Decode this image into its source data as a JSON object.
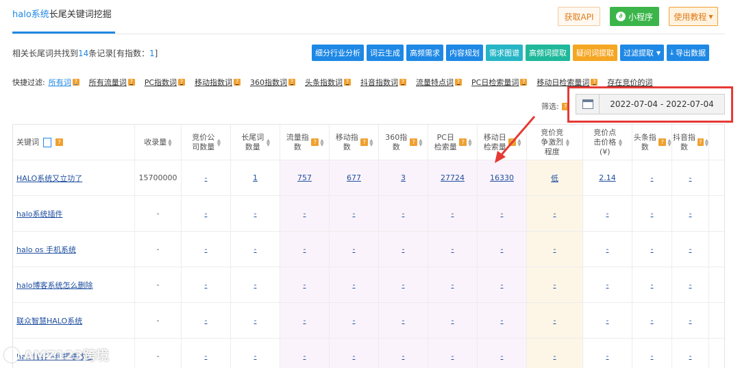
{
  "header": {
    "brand": "halo系统",
    "title_suffix": "长尾关键词挖掘",
    "api_button": "获取API",
    "mini_button": "小程序",
    "tutorial_button": "使用教程"
  },
  "summary": {
    "prefix": "相关长尾词共找到",
    "count": "14",
    "middle": "条记录[有指数：",
    "indexed": "1",
    "suffix": "]"
  },
  "toolbar": [
    {
      "label": "细分行业分析",
      "style": "blue"
    },
    {
      "label": "词云生成",
      "style": "blue"
    },
    {
      "label": "高频需求",
      "style": "blue"
    },
    {
      "label": "内容规划",
      "style": "blue"
    },
    {
      "label": "需求图谱",
      "style": "teal"
    },
    {
      "label": "高频词提取",
      "style": "green"
    },
    {
      "label": "疑问词提取",
      "style": "orange"
    },
    {
      "label": "过滤提取",
      "style": "blue"
    },
    {
      "label": "导出数据",
      "style": "blue"
    }
  ],
  "quick_filter": {
    "label": "快捷过滤:",
    "items": [
      "所有词",
      "所有流量词",
      "PC指数词",
      "移动指数词",
      "360指数词",
      "头条指数词",
      "抖音指数词",
      "流量特点词",
      "PC日检索量词",
      "移动日检索量词",
      "存在竞价的词"
    ]
  },
  "filter": {
    "label": "筛选:",
    "date_range": "2022-07-04 - 2022-07-04"
  },
  "table": {
    "headers": [
      "关键词",
      "收录量",
      "竞价公司数量",
      "长尾词数量",
      "流量指数",
      "移动指数",
      "360指数",
      "PC日检索量",
      "移动日检索量",
      "竞价竞争激烈程度",
      "竞价点击价格(¥)",
      "头条指数",
      "抖音指数"
    ],
    "rows": [
      [
        "HALO系统又立功了",
        "15700000",
        "-",
        "1",
        "757",
        "677",
        "3",
        "27724",
        "16330",
        "低",
        "2.14",
        "-",
        "-"
      ],
      [
        "halo系统插件",
        "-",
        "-",
        "-",
        "-",
        "-",
        "-",
        "-",
        "-",
        "-",
        "-",
        "-",
        "-"
      ],
      [
        "halo os 手机系统",
        "-",
        "-",
        "-",
        "-",
        "-",
        "-",
        "-",
        "-",
        "-",
        "-",
        "-",
        "-"
      ],
      [
        "halo博客系统怎么删除",
        "-",
        "-",
        "-",
        "-",
        "-",
        "-",
        "-",
        "-",
        "-",
        "-",
        "-",
        "-"
      ],
      [
        "联众智慧HALO系统",
        "-",
        "-",
        "-",
        "-",
        "-",
        "-",
        "-",
        "-",
        "-",
        "-",
        "-",
        "-"
      ],
      [
        "halo博客系统搭建教程",
        "-",
        "-",
        "-",
        "-",
        "-",
        "-",
        "-",
        "-",
        "-",
        "-",
        "-",
        "-"
      ]
    ]
  },
  "watermark": "AMZ123跨境"
}
